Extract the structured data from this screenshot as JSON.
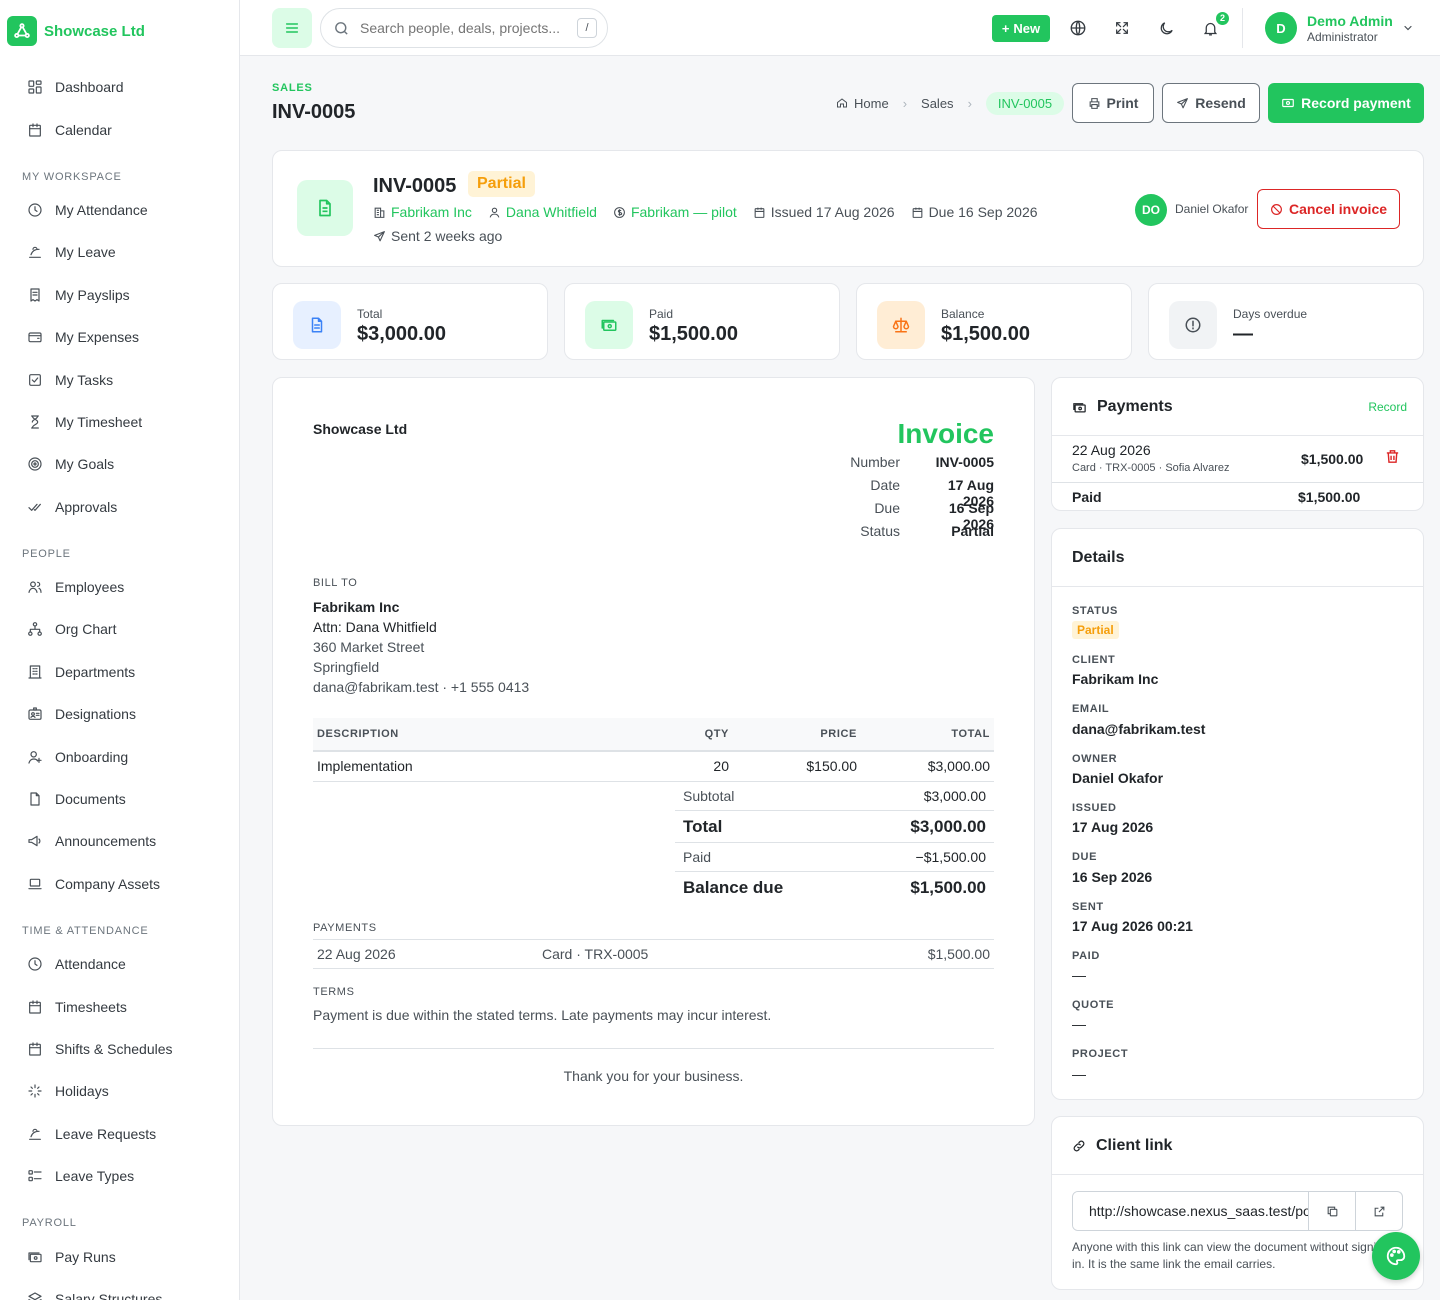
{
  "brand": {
    "name": "Showcase Ltd"
  },
  "sidebar": {
    "top": [
      {
        "label": "Dashboard",
        "icon": "dashboard-icon"
      },
      {
        "label": "Calendar",
        "icon": "calendar-icon"
      }
    ],
    "sections": [
      {
        "title": "MY WORKSPACE",
        "items": [
          "My Attendance",
          "My Leave",
          "My Payslips",
          "My Expenses",
          "My Tasks",
          "My Timesheet",
          "My Goals",
          "Approvals"
        ]
      },
      {
        "title": "PEOPLE",
        "items": [
          "Employees",
          "Org Chart",
          "Departments",
          "Designations",
          "Onboarding",
          "Documents",
          "Announcements",
          "Company Assets"
        ]
      },
      {
        "title": "TIME & ATTENDANCE",
        "items": [
          "Attendance",
          "Timesheets",
          "Shifts & Schedules",
          "Holidays",
          "Leave Requests",
          "Leave Types"
        ]
      },
      {
        "title": "PAYROLL",
        "items": [
          "Pay Runs",
          "Salary Structures"
        ]
      }
    ]
  },
  "topbar": {
    "search_placeholder": "Search people, deals, projects...",
    "search_shortcut": "/",
    "new_label": "New",
    "notification_count": "2",
    "user": {
      "initial": "D",
      "name": "Demo Admin",
      "role": "Administrator"
    }
  },
  "page": {
    "eyebrow": "SALES",
    "title": "INV-0005",
    "breadcrumbs": [
      "Home",
      "Sales",
      "INV-0005"
    ],
    "actions": {
      "print": "Print",
      "resend": "Resend",
      "record_payment": "Record payment"
    }
  },
  "summary": {
    "number": "INV-0005",
    "status": "Partial",
    "client": "Fabrikam Inc",
    "contact": "Dana Whitfield",
    "deal": "Fabrikam — pilot",
    "issued": "Issued 17 Aug 2026",
    "due": "Due 16 Sep 2026",
    "sent": "Sent 2 weeks ago",
    "owner_initials": "DO",
    "owner_name": "Daniel Okafor",
    "cancel_label": "Cancel invoice"
  },
  "stats": [
    {
      "label": "Total",
      "value": "$3,000.00",
      "icon": "document-icon",
      "bg": "#e7f0ff",
      "color": "#3b82f6"
    },
    {
      "label": "Paid",
      "value": "$1,500.00",
      "icon": "cash-icon",
      "bg": "#dcfce7",
      "color": "#22c55e"
    },
    {
      "label": "Balance",
      "value": "$1,500.00",
      "icon": "scale-icon",
      "bg": "#ffedd5",
      "color": "#f97316"
    },
    {
      "label": "Days overdue",
      "value": "—",
      "icon": "alert-circle-icon",
      "bg": "#f1f3f5",
      "color": "#495057"
    }
  ],
  "invoice": {
    "company": "Showcase Ltd",
    "heading": "Invoice",
    "meta": [
      {
        "k": "Number",
        "v": "INV-0005"
      },
      {
        "k": "Date",
        "v": "17 Aug 2026"
      },
      {
        "k": "Due",
        "v": "16 Sep 2026"
      },
      {
        "k": "Status",
        "v": "Partial"
      }
    ],
    "bill_to_label": "BILL TO",
    "bill_to": {
      "name": "Fabrikam Inc",
      "attn": "Attn: Dana Whitfield",
      "street": "360 Market Street",
      "city": "Springfield",
      "contact": "dana@fabrikam.test · +1 555 0413"
    },
    "columns": [
      "DESCRIPTION",
      "QTY",
      "PRICE",
      "TOTAL"
    ],
    "items": [
      {
        "description": "Implementation",
        "qty": "20",
        "price": "$150.00",
        "total": "$3,000.00"
      }
    ],
    "totals": {
      "subtotal_label": "Subtotal",
      "subtotal": "$3,000.00",
      "total_label": "Total",
      "total": "$3,000.00",
      "paid_label": "Paid",
      "paid": "−$1,500.00",
      "balance_label": "Balance due",
      "balance": "$1,500.00"
    },
    "payments_label": "PAYMENTS",
    "payments": [
      {
        "date": "22 Aug 2026",
        "method": "Card · TRX-0005",
        "amount": "$1,500.00"
      }
    ],
    "terms_label": "TERMS",
    "terms": "Payment is due within the stated terms. Late payments may incur interest.",
    "footer": "Thank you for your business."
  },
  "payments_card": {
    "title": "Payments",
    "record_label": "Record",
    "entries": [
      {
        "date": "22 Aug 2026",
        "detail": "Card · TRX-0005 · Sofia Alvarez",
        "amount": "$1,500.00"
      }
    ],
    "paid_label": "Paid",
    "paid_total": "$1,500.00"
  },
  "details": {
    "title": "Details",
    "status_label": "STATUS",
    "status": "Partial",
    "client_label": "CLIENT",
    "client": "Fabrikam Inc",
    "email_label": "EMAIL",
    "email": "dana@fabrikam.test",
    "owner_label": "OWNER",
    "owner": "Daniel Okafor",
    "issued_label": "ISSUED",
    "issued": "17 Aug 2026",
    "due_label": "DUE",
    "due": "16 Sep 2026",
    "sent_label": "SENT",
    "sent": "17 Aug 2026 00:21",
    "paid_label": "PAID",
    "paid": "—",
    "quote_label": "QUOTE",
    "quote": "—",
    "project_label": "PROJECT",
    "project": "—"
  },
  "client_link": {
    "title": "Client link",
    "url": "http://showcase.nexus_saas.test/portal/invoice",
    "note": "Anyone with this link can view the document without signing in. It is the same link the email carries."
  },
  "colors": {
    "accent": "#22c55e",
    "danger": "#dc2626",
    "warning": "#f59e0b"
  }
}
